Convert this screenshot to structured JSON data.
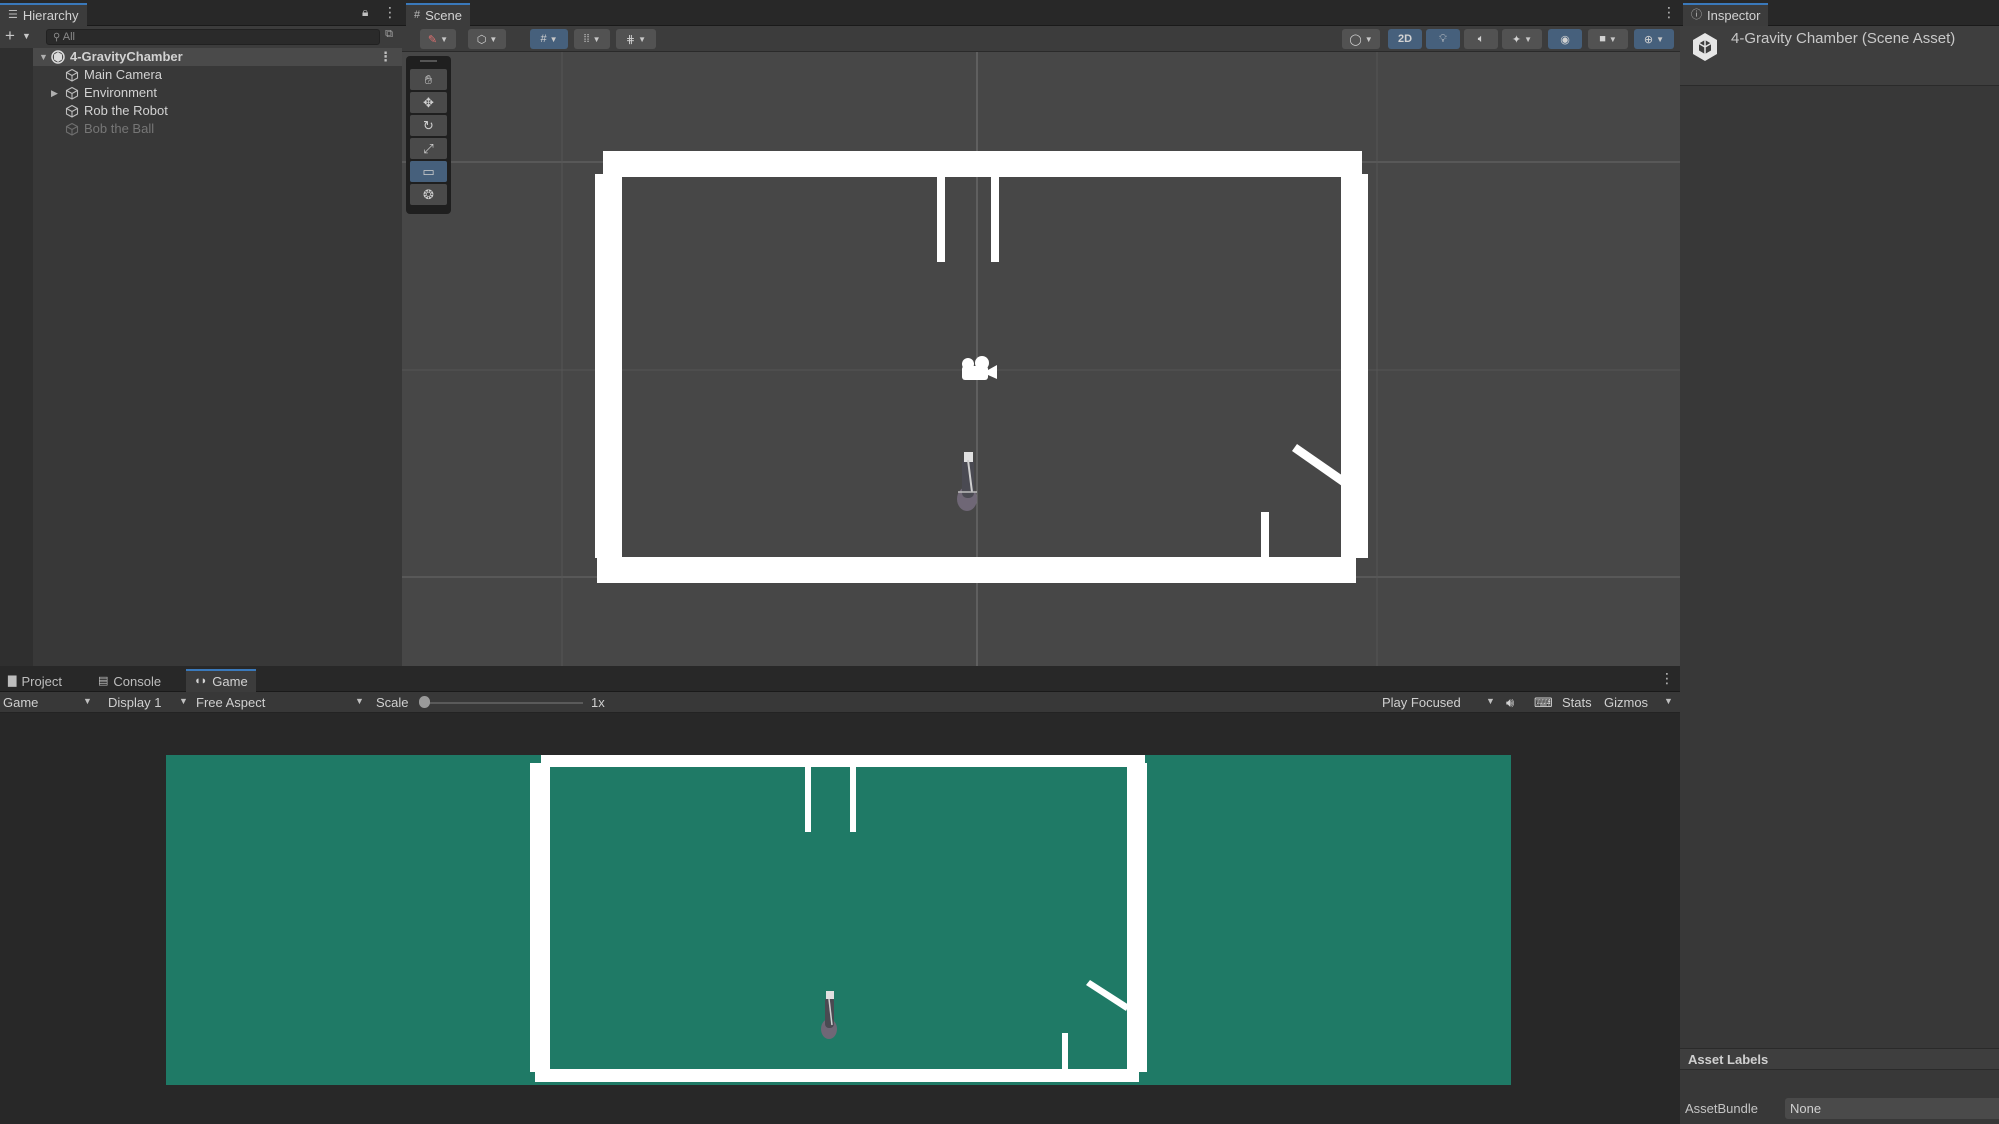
{
  "hierarchy": {
    "tab": "Hierarchy",
    "search_placeholder": "All",
    "scene_name": "4-GravityChamber",
    "items": [
      {
        "label": "Main Camera"
      },
      {
        "label": "Environment"
      },
      {
        "label": "Rob the Robot"
      },
      {
        "label": "Bob the Ball"
      }
    ]
  },
  "scene": {
    "tab": "Scene",
    "toggle_2d": "2D"
  },
  "inspector": {
    "tab": "Inspector",
    "title": "4-Gravity Chamber (Scene Asset)",
    "asset_labels": "Asset Labels",
    "assetbundle_label": "AssetBundle",
    "assetbundle_value": "None"
  },
  "bottom": {
    "tabs": {
      "project": "Project",
      "console": "Console",
      "game": "Game"
    },
    "game_select": "Game",
    "display": "Display 1",
    "aspect": "Free Aspect",
    "scale_label": "Scale",
    "scale_value": "1x",
    "play_mode": "Play Focused",
    "stats": "Stats",
    "gizmos": "Gizmos"
  },
  "colors": {
    "game_background": "#1f7a66",
    "scene_background": "#474747",
    "walls": "#ffffff",
    "active_accent": "#46607c"
  }
}
